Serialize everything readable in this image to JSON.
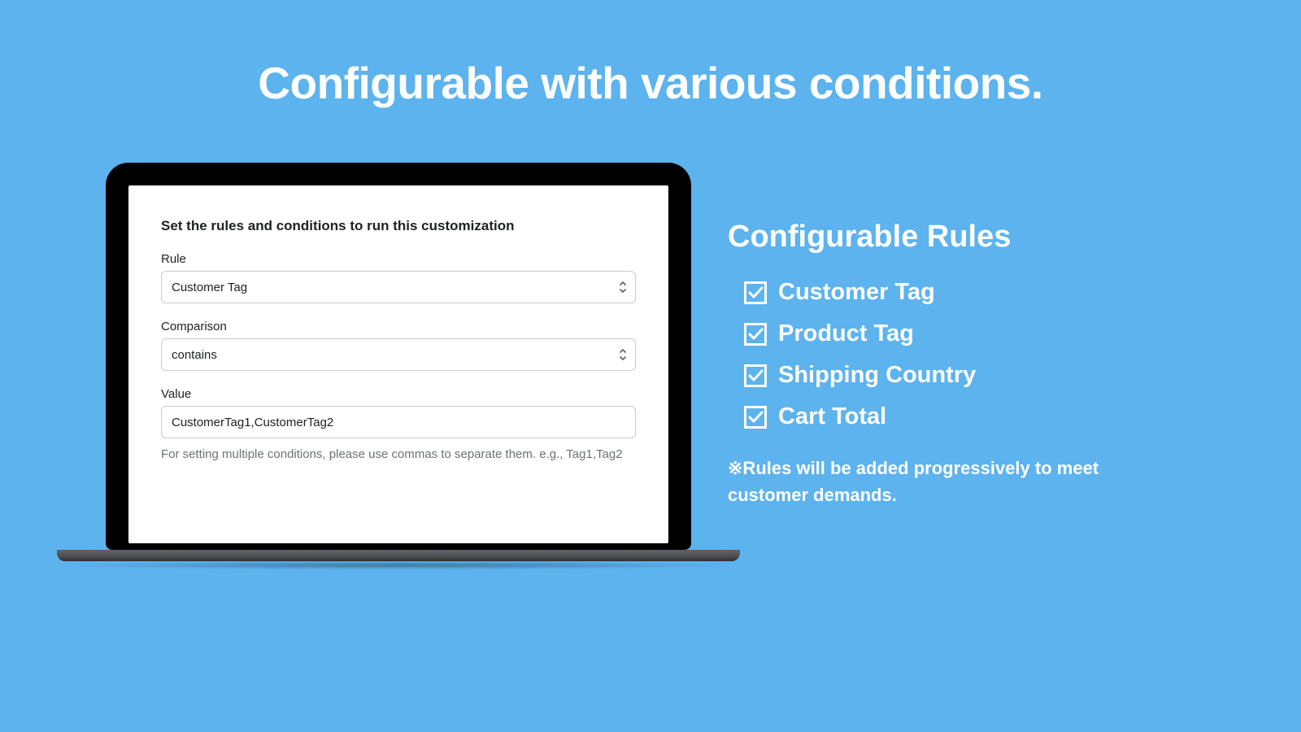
{
  "headline": "Configurable with various conditions.",
  "form": {
    "title": "Set the rules and conditions to run this customization",
    "rule": {
      "label": "Rule",
      "value": "Customer Tag"
    },
    "comparison": {
      "label": "Comparison",
      "value": "contains"
    },
    "valueField": {
      "label": "Value",
      "value": "CustomerTag1,CustomerTag2",
      "helper": "For setting multiple conditions, please use commas to separate them. e.g., Tag1,Tag2"
    }
  },
  "rules": {
    "heading": "Configurable Rules",
    "items": [
      {
        "label": "Customer Tag"
      },
      {
        "label": "Product Tag"
      },
      {
        "label": "Shipping Country"
      },
      {
        "label": "Cart Total"
      }
    ],
    "note": "※Rules will be added progressively to meet customer demands."
  }
}
